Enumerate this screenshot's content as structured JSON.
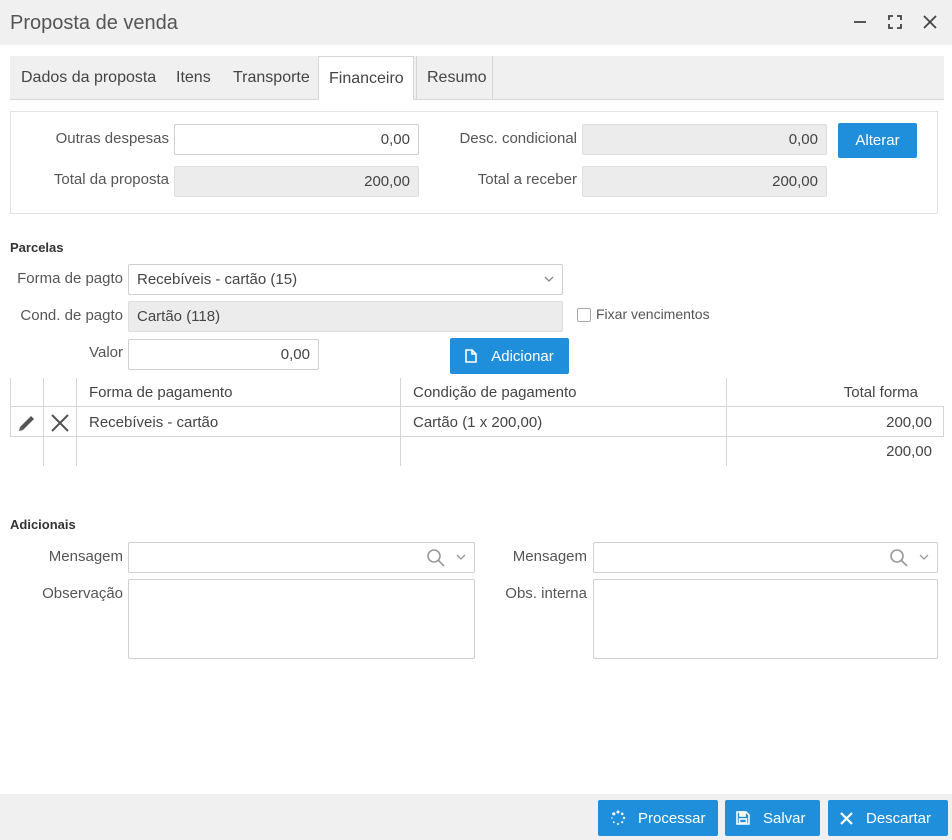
{
  "window": {
    "title": "Proposta de venda"
  },
  "tabs": [
    {
      "label": "Dados da proposta"
    },
    {
      "label": "Itens"
    },
    {
      "label": "Transporte"
    },
    {
      "label": "Financeiro"
    },
    {
      "label": "Resumo"
    }
  ],
  "active_tab": "Financeiro",
  "totals": {
    "outras_despesas_label": "Outras despesas",
    "outras_despesas_value": "0,00",
    "desc_condicional_label": "Desc. condicional",
    "desc_condicional_value": "0,00",
    "alterar_label": "Alterar",
    "total_proposta_label": "Total da proposta",
    "total_proposta_value": "200,00",
    "total_receber_label": "Total a receber",
    "total_receber_value": "200,00"
  },
  "parcelas": {
    "section_title": "Parcelas",
    "forma_pagto_label": "Forma de pagto",
    "forma_pagto_value": "Recebíveis - cartão (15)",
    "cond_pagto_label": "Cond. de pagto",
    "cond_pagto_value": "Cartão (118)",
    "fixar_label": "Fixar vencimentos",
    "fixar_checked": false,
    "valor_label": "Valor",
    "valor_value": "0,00",
    "adicionar_label": "Adicionar"
  },
  "grid": {
    "columns": [
      "Forma de pagamento",
      "Condição de pagamento",
      "Total forma"
    ],
    "rows": [
      {
        "forma": "Recebíveis - cartão",
        "condicao": "Cartão (1 x 200,00)",
        "total": "200,00"
      }
    ],
    "footer_total": "200,00"
  },
  "adicionais": {
    "section_title": "Adicionais",
    "mensagem_label_1": "Mensagem",
    "mensagem_label_2": "Mensagem",
    "observacao_label": "Observação",
    "obs_interna_label": "Obs. interna"
  },
  "footer": {
    "processar_label": "Processar",
    "salvar_label": "Salvar",
    "descartar_label": "Descartar"
  },
  "colors": {
    "accent": "#1f8fdc",
    "bar_bg": "#f0f0f0",
    "readonly_bg": "#ececec"
  }
}
